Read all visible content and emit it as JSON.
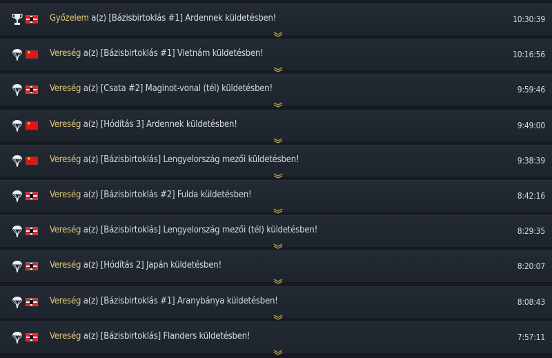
{
  "colors": {
    "background": "#171b21",
    "row": "#222932",
    "result_text": "#e2c777",
    "body_text": "#d6d9de",
    "expand_chevron": "#b89a46"
  },
  "connector": "a(z)",
  "suffix": "küldetésben!",
  "battles": [
    {
      "result": "Győzelem",
      "mission": "[Bázisbirtoklás #1] Ardennek",
      "time": "10:30:39",
      "badge": "trophy-icon",
      "flag": "de"
    },
    {
      "result": "Vereség",
      "mission": "[Bázisbirtoklás #1] Vietnám",
      "time": "10:16:56",
      "badge": "parachute-icon",
      "flag": "cn"
    },
    {
      "result": "Vereség",
      "mission": "[Csata #2] Maginot-vonal (tél)",
      "time": "9:59:46",
      "badge": "parachute-icon",
      "flag": "de"
    },
    {
      "result": "Vereség",
      "mission": "[Hódítás 3] Ardennek",
      "time": "9:49:00",
      "badge": "parachute-icon",
      "flag": "cn"
    },
    {
      "result": "Vereség",
      "mission": "[Bázisbirtoklás] Lengyelország mezői",
      "time": "9:38:39",
      "badge": "parachute-icon",
      "flag": "cn"
    },
    {
      "result": "Vereség",
      "mission": "[Bázisbirtoklás #2] Fulda",
      "time": "8:42:16",
      "badge": "parachute-icon",
      "flag": "de"
    },
    {
      "result": "Vereség",
      "mission": "[Bázisbirtoklás] Lengyelország mezői (tél)",
      "time": "8:29:35",
      "badge": "parachute-icon",
      "flag": "de"
    },
    {
      "result": "Vereség",
      "mission": "[Hódítás 2] Japán",
      "time": "8:20:07",
      "badge": "parachute-icon",
      "flag": "de"
    },
    {
      "result": "Vereség",
      "mission": "[Bázisbirtoklás #1] Aranybánya",
      "time": "8:08:43",
      "badge": "parachute-icon",
      "flag": "de"
    },
    {
      "result": "Vereség",
      "mission": "[Bázisbirtoklás] Flanders",
      "time": "7:57:11",
      "badge": "parachute-icon",
      "flag": "de"
    }
  ]
}
